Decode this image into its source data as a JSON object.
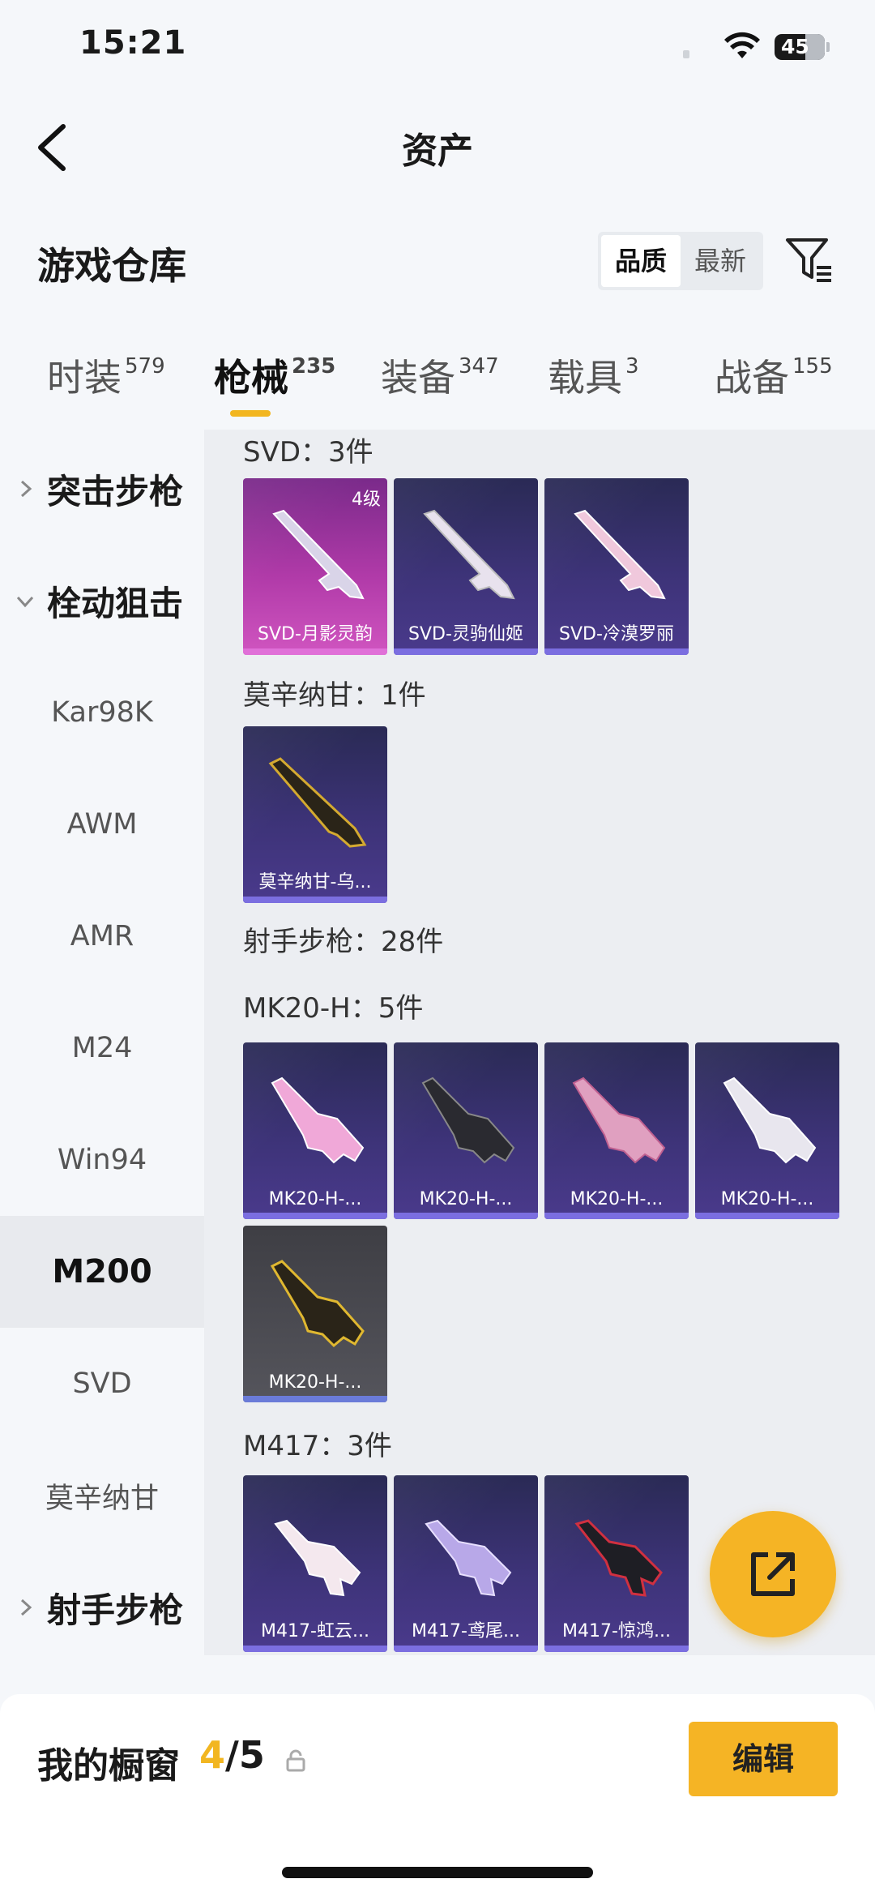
{
  "status": {
    "time": "15:21",
    "battery": "45"
  },
  "nav": {
    "title": "资产"
  },
  "header": {
    "section_title": "游戏仓库",
    "sort_options": [
      "品质",
      "最新"
    ]
  },
  "tabs": [
    {
      "label": "时装",
      "count": "579"
    },
    {
      "label": "枪械",
      "count": "235"
    },
    {
      "label": "装备",
      "count": "347"
    },
    {
      "label": "载具",
      "count": "3"
    },
    {
      "label": "战备",
      "count": "155"
    }
  ],
  "sidebar": {
    "items": [
      {
        "label": "突击步枪"
      },
      {
        "label": "栓动狙击"
      },
      {
        "label": "Kar98K"
      },
      {
        "label": "AWM"
      },
      {
        "label": "AMR"
      },
      {
        "label": "M24"
      },
      {
        "label": "Win94"
      },
      {
        "label": "M200"
      },
      {
        "label": "SVD"
      },
      {
        "label": "莫辛纳甘"
      },
      {
        "label": "射手步枪"
      }
    ]
  },
  "content": {
    "groups": [
      {
        "label": "SVD：3件",
        "cards": [
          {
            "name": "SVD-月影灵韵",
            "tier": "4级"
          },
          {
            "name": "SVD-灵驹仙姬"
          },
          {
            "name": "SVD-冷漠罗丽"
          }
        ]
      },
      {
        "label": "莫辛纳甘：1件",
        "cards": [
          {
            "name": "莫辛纳甘-乌..."
          }
        ]
      },
      {
        "label": "射手步枪：28件"
      },
      {
        "label": "MK20-H：5件",
        "cards": [
          {
            "name": "MK20-H-..."
          },
          {
            "name": "MK20-H-..."
          },
          {
            "name": "MK20-H-..."
          },
          {
            "name": "MK20-H-..."
          },
          {
            "name": "MK20-H-..."
          }
        ]
      },
      {
        "label": "M417：3件",
        "cards": [
          {
            "name": "M417-虹云..."
          },
          {
            "name": "M417-鸢尾..."
          },
          {
            "name": "M417-惊鸿..."
          }
        ]
      }
    ]
  },
  "showcase": {
    "title": "我的橱窗",
    "current": "4",
    "total": "/5",
    "edit_label": "编辑"
  },
  "colors": {
    "accent": "#f5b425",
    "legendary": "#c84ab8",
    "epic": "#4a3a8c"
  }
}
